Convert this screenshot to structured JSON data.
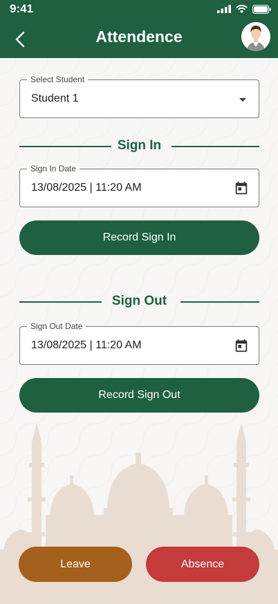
{
  "status_bar": {
    "time": "9:41"
  },
  "header": {
    "title": "Attendence"
  },
  "student_select": {
    "label": "Select Student",
    "value": "Student 1"
  },
  "sign_in": {
    "section_title": "Sign In",
    "date_label": "Sign In Date",
    "date_value": "13/08/2025 | 11:20 AM",
    "button_label": "Record Sign In"
  },
  "sign_out": {
    "section_title": "Sign Out",
    "date_label": "Sign Out Date",
    "date_value": "13/08/2025 | 11:20 AM",
    "button_label": "Record Sign Out"
  },
  "actions": {
    "leave_label": "Leave",
    "absence_label": "Absence"
  },
  "colors": {
    "primary": "#1e6040",
    "leave": "#a5601b",
    "absence": "#c53a3a",
    "mosque": "#e9ddd2"
  },
  "icons": {
    "back": "chevron-left-icon",
    "calendar": "calendar-icon",
    "dropdown": "caret-down-icon",
    "signal": "signal-icon",
    "wifi": "wifi-icon",
    "battery": "battery-icon"
  }
}
